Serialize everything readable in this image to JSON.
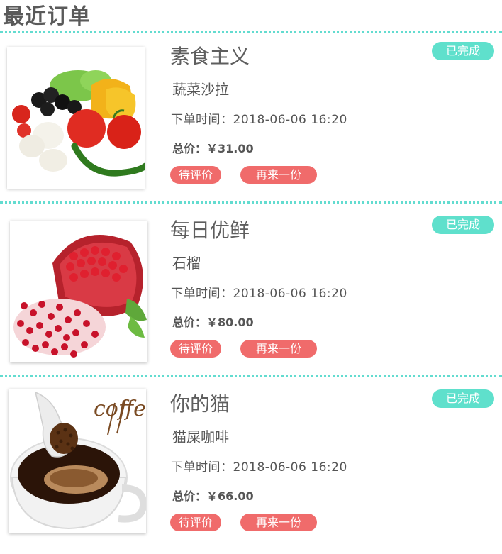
{
  "page": {
    "title": "最近订单"
  },
  "orders": [
    {
      "shop": "素食主义",
      "product": "蔬菜沙拉",
      "time_label": "下单时间：",
      "date": "2018-06-06",
      "time": "16:20",
      "price_label": "总价：",
      "price": "￥31.00",
      "status": "已完成",
      "review_label": "待评价",
      "reorder_label": "再来一份",
      "image": "vegetables-photo"
    },
    {
      "shop": "每日优鲜",
      "product": "石榴",
      "time_label": "下单时间：",
      "date": "2018-06-06",
      "time": "16:20",
      "price_label": "总价：",
      "price": "￥80.00",
      "status": "已完成",
      "review_label": "待评价",
      "reorder_label": "再来一份",
      "image": "pomegranate-photo"
    },
    {
      "shop": "你的猫",
      "product": "猫屎咖啡",
      "time_label": "下单时间：",
      "date": "2018-06-06",
      "time": "16:20",
      "price_label": "总价：",
      "price": "￥66.00",
      "status": "已完成",
      "review_label": "待评价",
      "reorder_label": "再来一份",
      "image": "coffee-photo",
      "image_text": "coffe"
    }
  ],
  "colors": {
    "divider": "#63dcd0",
    "status_badge": "#5fe0cc",
    "action_button": "#f06b6b",
    "text": "#555555"
  }
}
